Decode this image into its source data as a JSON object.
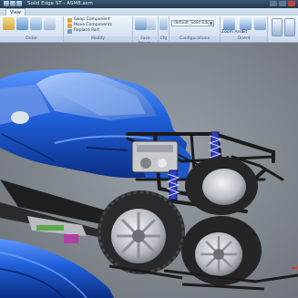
{
  "window": {
    "title": "Solid Edge ST - ASM8.asm"
  },
  "tabs": [
    {
      "label": "View"
    }
  ],
  "ribbon": {
    "groups": [
      {
        "label": "Order"
      },
      {
        "label": "Modify"
      },
      {
        "label": "Face Priority"
      },
      {
        "label": "Cfg"
      },
      {
        "label": "Configurations"
      },
      {
        "label": "Orient"
      }
    ],
    "modify": {
      "swap_label": "Swap Component",
      "move_label": "Move Components",
      "replace_label": "Replace Part"
    },
    "configurations": {
      "current": "default_Solid Edge"
    },
    "orient": {
      "zoom_label": "Zoom Area",
      "fit_label": "Fit"
    }
  },
  "viewport": {
    "colors": {
      "body": "#1f5fd8",
      "background": "#7d8289",
      "frame": "#1c1c1c",
      "tire": "#2a2a2a",
      "rim": "#c9ccd1",
      "spring": "#2f3fbf"
    }
  }
}
